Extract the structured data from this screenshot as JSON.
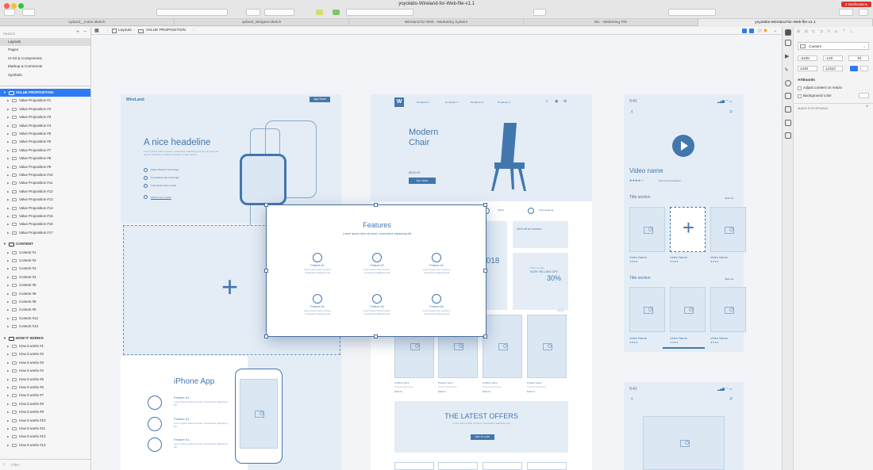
{
  "window": {
    "title": "yoyolabs-Wireland-for-Web-file-v1.1",
    "notifications": "3 Notifications"
  },
  "tabs": [
    {
      "label": "upland__icons.sketch",
      "active": false
    },
    {
      "label": "upland_Widgets.sketch",
      "active": false
    },
    {
      "label": "Wireland for Web - Marketing System",
      "active": false
    },
    {
      "label": "WL - Marketing File",
      "active": false
    },
    {
      "label": "yoyolabs-Wireland-for-Web-file-v1.1",
      "active": true
    }
  ],
  "breadcrumb": [
    "Layouts",
    "VALUE PROPOSITION"
  ],
  "sidebar": {
    "pages_label": "PAGES",
    "pages": [
      "Layouts",
      "Pages",
      "UI Kit & Components",
      "Markup & Comments",
      "Symbols"
    ],
    "selected_page": "Layouts",
    "groups": [
      {
        "name": "VALUE PROPOSITION",
        "selected": true,
        "layers": [
          "Value Proposition #1",
          "Value Proposition #2",
          "Value Proposition #3",
          "Value Proposition #4",
          "Value Proposition #5",
          "Value Proposition #6",
          "Value Proposition #7",
          "Value Proposition #8",
          "Value Proposition #9",
          "Value Proposition #10",
          "Value Proposition #11",
          "Value Proposition #12",
          "Value Proposition #13",
          "Value Proposition #14",
          "Value Proposition #15",
          "Value Proposition #16",
          "Value Proposition #17"
        ]
      },
      {
        "name": "CONTENT",
        "selected": false,
        "layers": [
          "Content #1",
          "Content #2",
          "Content #3",
          "Content #4",
          "Content #5",
          "Content #6",
          "Content #8",
          "Content #9",
          "Content #12",
          "Content #13"
        ]
      },
      {
        "name": "HOW IT WORKS",
        "selected": false,
        "layers": [
          "How it works #1",
          "How it works #2",
          "How it works #3",
          "How it works #4",
          "How it works #5",
          "How it works #6",
          "How it works #7",
          "How it works #8",
          "How it works #9",
          "How it works #10",
          "How it works #11",
          "How it works #12",
          "How it works #13"
        ]
      }
    ],
    "filter_placeholder": "Filter"
  },
  "canvas": {
    "hero": {
      "logo": "WireLand",
      "store_badge": "App Store",
      "headline": "A nice headeline",
      "body": "Lorem ipsum dolor sit amet, consectetur adipiscing elit sed do eiusmod tempor incididunt ut labore et dolore magna aliqua.",
      "bullets": [
        "Make Wireless Technology",
        "Compatible Input Cartridge",
        "Fully Responsive Profile"
      ],
      "link": "Watch how it works"
    },
    "chair": {
      "nav": [
        "Dropdown ▾",
        "Dropdown ▾",
        "Dropdown ▾",
        "Dropdown ▾"
      ],
      "headline_1": "Modern",
      "headline_2": "Chair",
      "price": "$394.00",
      "button": "BUY NOW"
    },
    "features": {
      "title": "Features",
      "subtitle": "Lorem ipsum dolor sit amet, consectetur adipiscing elit",
      "items": [
        {
          "title": "Feature #1",
          "desc": "Lorem ipsum dolor sit amet, consectetur adipiscing elit"
        },
        {
          "title": "Feature #2",
          "desc": "Lorem ipsum dolor sit amet, consectetur adipiscing elit"
        },
        {
          "title": "Feature #3",
          "desc": "Lorem ipsum dolor sit amet, consectetur adipiscing elit"
        },
        {
          "title": "Feature #4",
          "desc": "Lorem ipsum dolor sit amet, consectetur adipiscing elit"
        },
        {
          "title": "Feature #5",
          "desc": "Lorem ipsum dolor sit amet, consectetur adipiscing elit"
        },
        {
          "title": "Feature #6",
          "desc": "Lorem ipsum dolor sit amet, consectetur adipiscing elit"
        }
      ]
    },
    "promo": {
      "offers": "Offers",
      "free_shipping": "Free shipping",
      "discount": "40% off on women",
      "year": "r 2018",
      "price_title": "Price is a title",
      "now_selling": "NOW SELLING OFF",
      "percent": "30%"
    },
    "products": {
      "name": "Product name",
      "desc": "Product description",
      "price": "$164.11"
    },
    "offers": {
      "title": "THE LATEST OFFERS",
      "subtitle": "Lorem ipsum dolor sit amet, consectetur adipiscing elit",
      "button": "ADD TO CART"
    },
    "iphone_app": {
      "title": "iPhone App",
      "features": [
        {
          "title": "Feature #1",
          "desc": "Lorem ipsum dolor sit amet, consectetur adipiscing elit."
        },
        {
          "title": "Feature #1",
          "desc": "Lorem ipsum dolor sit amet, consectetur adipiscing elit."
        },
        {
          "title": "Feature #1",
          "desc": "Lorem ipsum dolor sit amet, consectetur adipiscing elit."
        }
      ]
    },
    "mobile_1": {
      "time": "9:41",
      "video_name": "Video name",
      "rating_note": "This is the description",
      "section_1": "Title section",
      "see_all": "SEE ALL",
      "section_2": "Title section",
      "card_label": "Video Name"
    },
    "mobile_2": {
      "time": "9:41"
    }
  },
  "inspector": {
    "preset": "Custom",
    "x": "-4230",
    "y": "-120",
    "w": "1440",
    "h": "14310",
    "fit": "Fit",
    "artboards_label": "Artboards",
    "adjust_label": "Adjust content on resize",
    "bg_label": "Background color",
    "make_exportable": "MAKE EXPORTABLE"
  },
  "colors": {
    "accent": "#4277ad",
    "selection": "#2f7bf4",
    "wire_bg": "#e4edf6"
  }
}
